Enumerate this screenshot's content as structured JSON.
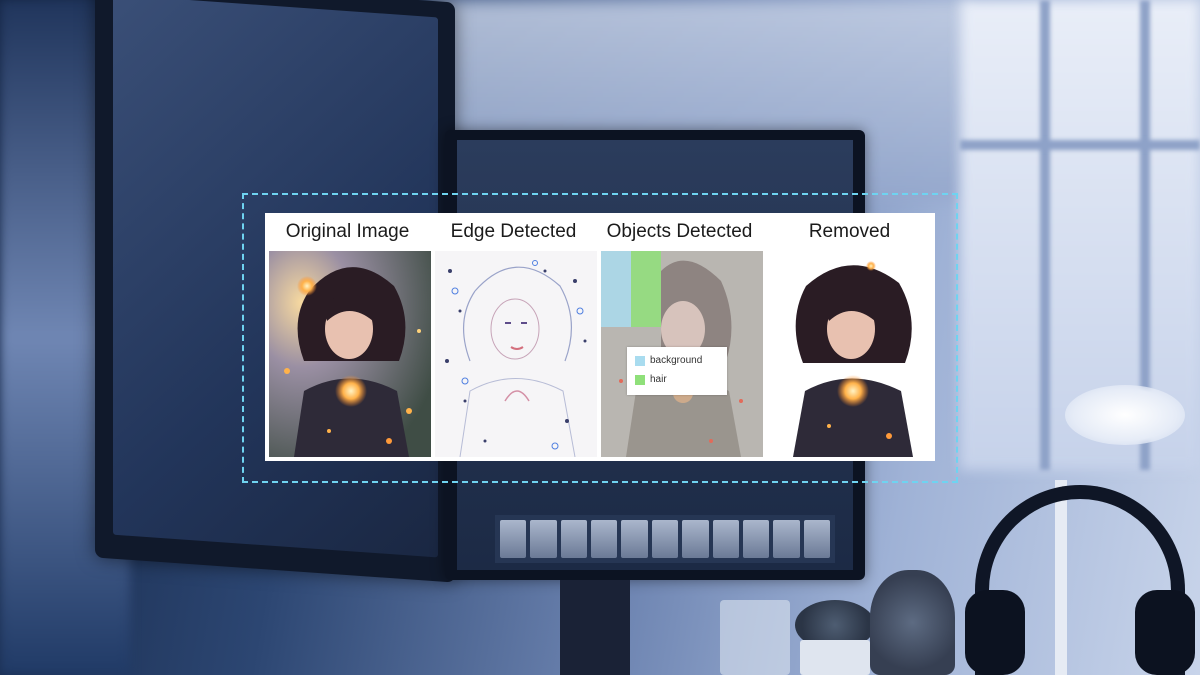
{
  "panels": [
    {
      "title": "Original Image"
    },
    {
      "title": "Edge Detected"
    },
    {
      "title": "Objects Detected"
    },
    {
      "title": "Removed"
    }
  ],
  "legend": {
    "items": [
      {
        "label": "background",
        "color": "#a9dcef"
      },
      {
        "label": "hair",
        "color": "#8fe07a"
      }
    ]
  },
  "colors": {
    "frame_dash": "#6fd3f0",
    "scene_tint": "#4a6496"
  }
}
